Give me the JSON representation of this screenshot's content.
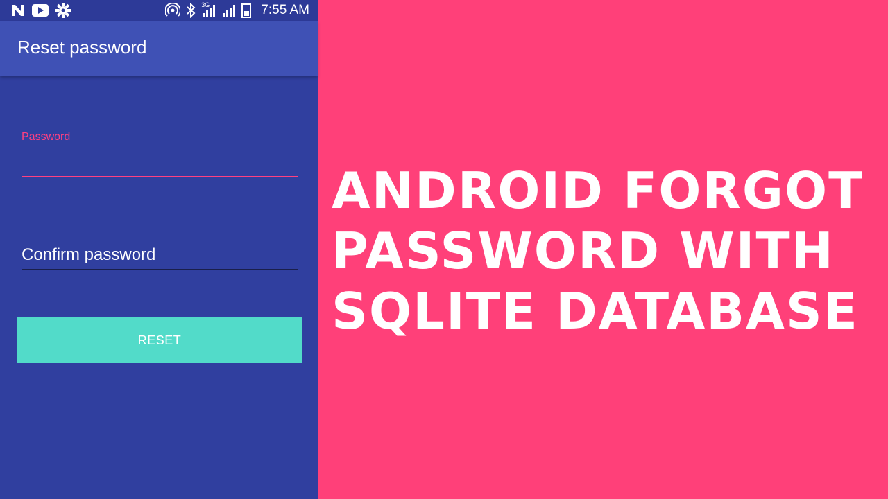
{
  "status_bar": {
    "time": "7:55 AM",
    "network": "3G",
    "icons": [
      "n-icon",
      "youtube-icon",
      "gear-icon",
      "hotspot-icon",
      "bluetooth-icon",
      "signal-icon",
      "signal-icon",
      "battery-icon"
    ]
  },
  "app_bar": {
    "title": "Reset password"
  },
  "form": {
    "password_label": "Password",
    "password_value": "",
    "confirm_label": "Confirm password",
    "reset_button": "RESET"
  },
  "headline": {
    "lines": [
      "ANDROID FORGOT",
      "PASSWORD WITH",
      "SQLITE DATABASE"
    ]
  },
  "colors": {
    "background": "#FF4079",
    "primary": "#3F51B5",
    "primary_dark": "#303F9F",
    "accent": "#FF4081",
    "button": "#52DBC9"
  }
}
